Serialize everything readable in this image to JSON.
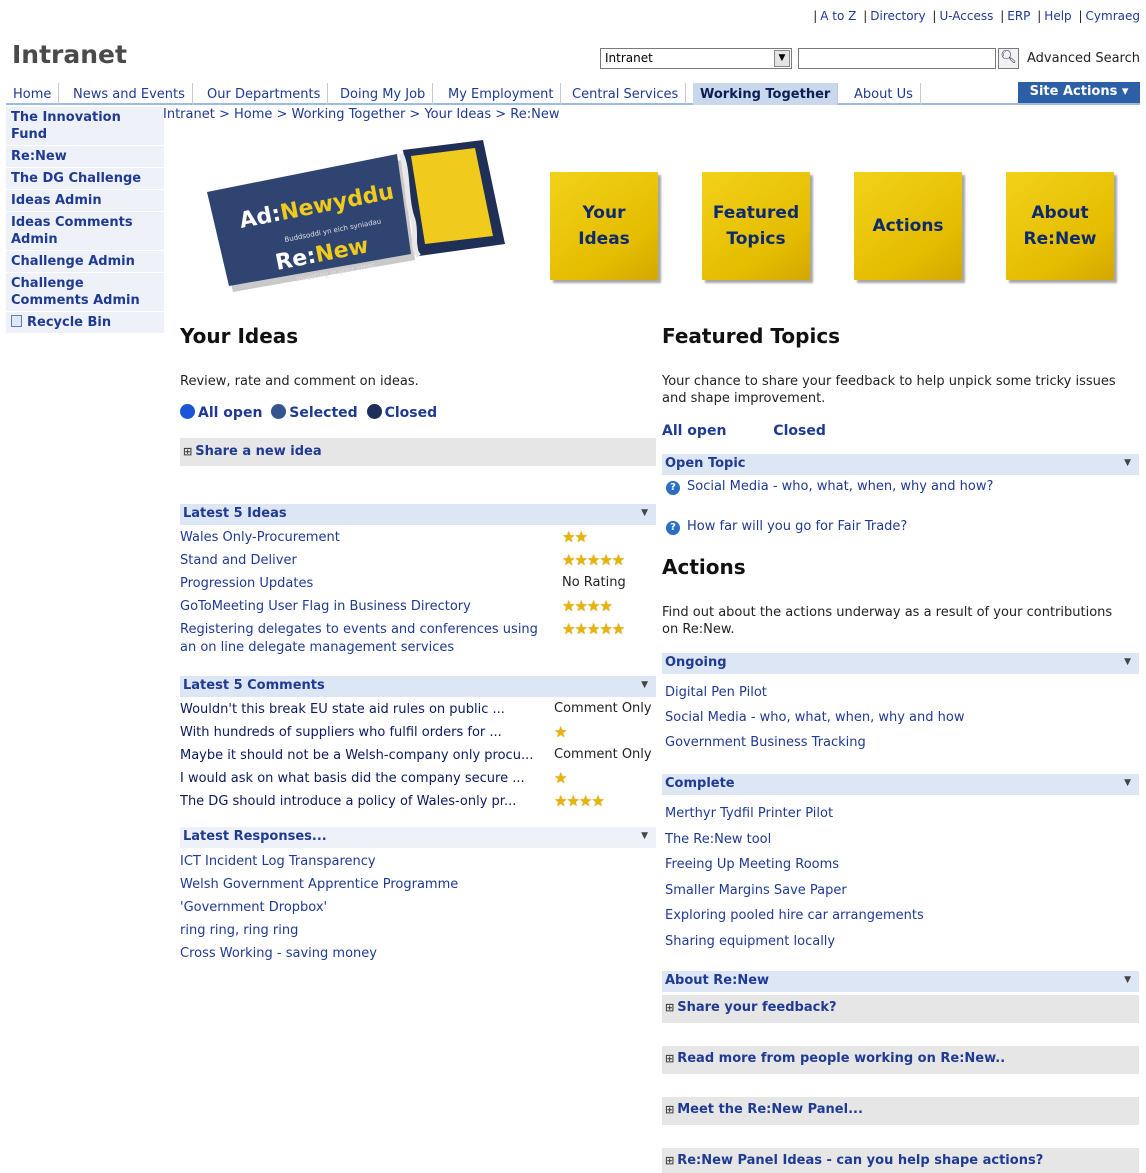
{
  "toplinks": [
    "A to Z",
    "Directory",
    "U-Access",
    "ERP",
    "Help",
    "Cymraeg"
  ],
  "site_title": "Intranet",
  "search": {
    "scope": "Intranet",
    "query": "",
    "advanced_label": "Advanced Search"
  },
  "nav": {
    "tabs": [
      "Home",
      "News and Events",
      "Our Departments",
      "Doing My Job",
      "My Employment",
      "Central Services",
      "Working Together",
      "About Us"
    ],
    "active": "Working Together",
    "site_actions": "Site Actions"
  },
  "quicklaunch": [
    "The Innovation Fund",
    "Re:New",
    "The DG Challenge",
    "Ideas Admin",
    "Ideas Comments Admin",
    "Challenge Admin",
    "Challenge Comments Admin",
    "Recycle Bin"
  ],
  "breadcrumb": "Intranet > Home > Working Together > Your Ideas > Re:New",
  "logo": {
    "line1a": "Ad:",
    "line1b": "Newyddu",
    "tag1": "Buddsoddi yn eich syniadau",
    "line2a": "Re:",
    "line2b": "New",
    "tag2": "Investing in your ideas"
  },
  "tiles": [
    "Your Ideas",
    "Featured Topics",
    "Actions",
    "About Re:New"
  ],
  "your_ideas": {
    "title": "Your Ideas",
    "desc": "Review, rate and comment on ideas.",
    "filters": [
      "All open",
      "Selected",
      "Closed"
    ],
    "share": "Share a new idea",
    "latest_ideas": {
      "title": "Latest 5 Ideas",
      "items": [
        {
          "text": "Wales Only-Procurement",
          "rating": 2
        },
        {
          "text": "Stand and Deliver",
          "rating": 5
        },
        {
          "text": "Progression Updates",
          "rating_text": "No Rating"
        },
        {
          "text": "GoToMeeting User Flag in Business Directory",
          "rating": 4
        },
        {
          "text": "Registering delegates to events and conferences using an on line delegate management services",
          "rating": 5
        }
      ]
    },
    "latest_comments": {
      "title": "Latest 5 Comments",
      "items": [
        {
          "text": "Wouldn't this break EU state aid rules on public ...",
          "rating_text": "Comment Only"
        },
        {
          "text": "With hundreds of suppliers who fulfil orders for ...",
          "rating": 1
        },
        {
          "text": "Maybe it should not be a Welsh-company only procu...",
          "rating_text": "Comment Only"
        },
        {
          "text": "I would ask on what basis did the company secure ...",
          "rating": 1
        },
        {
          "text": "The DG should introduce a policy of Wales-only pr...",
          "rating": 4
        }
      ]
    },
    "latest_responses": {
      "title": "Latest Responses...",
      "items": [
        "ICT Incident Log Transparency",
        "Welsh Government Apprentice Programme",
        "'Government Dropbox'",
        "ring ring, ring ring",
        "Cross Working - saving money"
      ]
    }
  },
  "featured_topics": {
    "title": "Featured Topics",
    "desc": "Your chance to share your feedback to help unpick some tricky issues and shape improvement.",
    "filters": [
      "All open",
      "Closed"
    ],
    "open_topic": {
      "title": "Open Topic",
      "items": [
        "Social Media - who, what, when, why and how?",
        "How far will you go for Fair Trade?"
      ]
    }
  },
  "actions": {
    "title": "Actions",
    "desc": "Find out about the actions underway as a result of your contributions on Re:New.",
    "ongoing": {
      "title": "Ongoing",
      "items": [
        "Digital Pen Pilot",
        "Social Media - who, what, when, why and how",
        "Government Business Tracking"
      ]
    },
    "complete": {
      "title": "Complete",
      "items": [
        "Merthyr Tydfil Printer Pilot",
        "The Re:New tool",
        "Freeing Up Meeting Rooms",
        "Smaller Margins Save Paper",
        "Exploring pooled hire car arrangements",
        "Sharing equipment locally"
      ]
    }
  },
  "about": {
    "title": "About Re:New",
    "items": [
      "Share your feedback?",
      "Read more from people working on Re:New..",
      "Meet the Re:New Panel...",
      "Re:New Panel Ideas - can you help shape actions?"
    ]
  },
  "colors": {
    "link": "#1f3a93",
    "tile": "#e7c200",
    "bar": "#dde6f4",
    "site_actions": "#2d5fa6",
    "star": "#e7b400"
  }
}
